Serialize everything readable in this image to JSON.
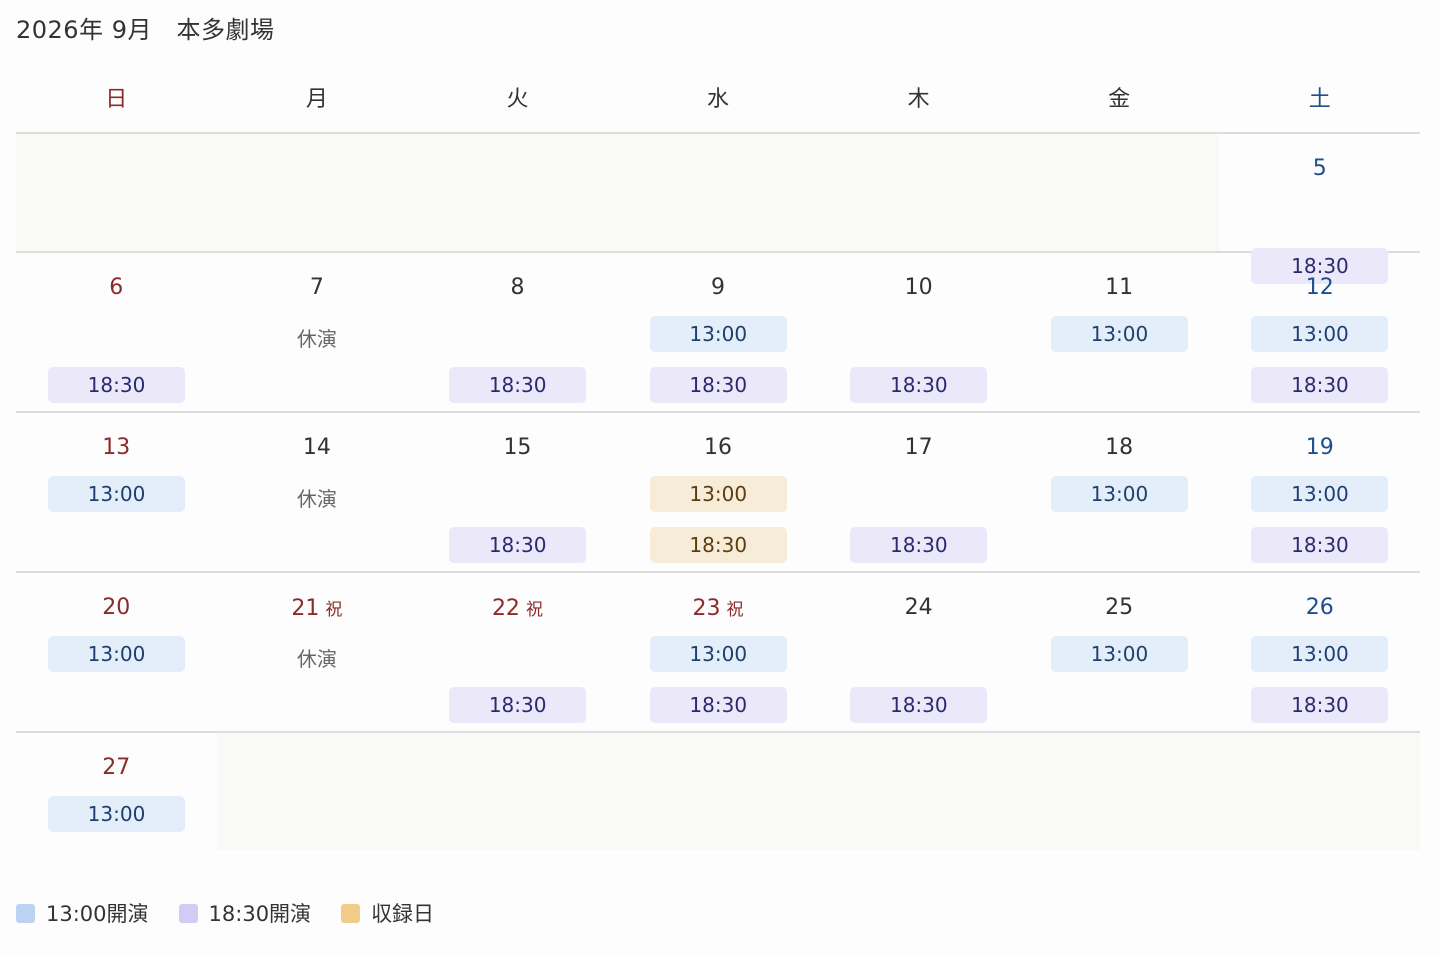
{
  "header": {
    "title": "2026年 9月　本多劇場"
  },
  "weekdays": [
    "日",
    "月",
    "火",
    "水",
    "木",
    "金",
    "土"
  ],
  "weeks": [
    {
      "days": [
        null,
        null,
        null,
        null,
        null,
        null,
        {
          "day": "5",
          "slots": [
            null,
            {
              "time": "18:30",
              "type": "t1830"
            }
          ]
        }
      ]
    },
    {
      "days": [
        {
          "day": "6",
          "slots": [
            null,
            {
              "time": "18:30",
              "type": "t1830"
            }
          ]
        },
        {
          "day": "7",
          "closed": "休演",
          "slots": [
            null,
            null
          ]
        },
        {
          "day": "8",
          "slots": [
            null,
            {
              "time": "18:30",
              "type": "t1830"
            }
          ]
        },
        {
          "day": "9",
          "slots": [
            {
              "time": "13:00",
              "type": "t1300"
            },
            {
              "time": "18:30",
              "type": "t1830"
            }
          ]
        },
        {
          "day": "10",
          "slots": [
            null,
            {
              "time": "18:30",
              "type": "t1830"
            }
          ]
        },
        {
          "day": "11",
          "slots": [
            {
              "time": "13:00",
              "type": "t1300"
            },
            null
          ]
        },
        {
          "day": "12",
          "slots": [
            {
              "time": "13:00",
              "type": "t1300"
            },
            {
              "time": "18:30",
              "type": "t1830"
            }
          ]
        }
      ]
    },
    {
      "days": [
        {
          "day": "13",
          "slots": [
            {
              "time": "13:00",
              "type": "t1300"
            },
            null
          ]
        },
        {
          "day": "14",
          "closed": "休演",
          "slots": [
            null,
            null
          ]
        },
        {
          "day": "15",
          "slots": [
            null,
            {
              "time": "18:30",
              "type": "t1830"
            }
          ]
        },
        {
          "day": "16",
          "slots": [
            {
              "time": "13:00",
              "type": "rec"
            },
            {
              "time": "18:30",
              "type": "rec"
            }
          ]
        },
        {
          "day": "17",
          "slots": [
            null,
            {
              "time": "18:30",
              "type": "t1830"
            }
          ]
        },
        {
          "day": "18",
          "slots": [
            {
              "time": "13:00",
              "type": "t1300"
            },
            null
          ]
        },
        {
          "day": "19",
          "slots": [
            {
              "time": "13:00",
              "type": "t1300"
            },
            {
              "time": "18:30",
              "type": "t1830"
            }
          ]
        }
      ]
    },
    {
      "days": [
        {
          "day": "20",
          "slots": [
            {
              "time": "13:00",
              "type": "t1300"
            },
            null
          ]
        },
        {
          "day": "21",
          "holiday": "祝",
          "closed": "休演",
          "slots": [
            null,
            null
          ]
        },
        {
          "day": "22",
          "holiday": "祝",
          "slots": [
            null,
            {
              "time": "18:30",
              "type": "t1830"
            }
          ]
        },
        {
          "day": "23",
          "holiday": "祝",
          "slots": [
            {
              "time": "13:00",
              "type": "t1300"
            },
            {
              "time": "18:30",
              "type": "t1830"
            }
          ]
        },
        {
          "day": "24",
          "slots": [
            null,
            {
              "time": "18:30",
              "type": "t1830"
            }
          ]
        },
        {
          "day": "25",
          "slots": [
            {
              "time": "13:00",
              "type": "t1300"
            },
            null
          ]
        },
        {
          "day": "26",
          "slots": [
            {
              "time": "13:00",
              "type": "t1300"
            },
            {
              "time": "18:30",
              "type": "t1830"
            }
          ]
        }
      ]
    },
    {
      "days": [
        {
          "day": "27",
          "slots": [
            {
              "time": "13:00",
              "type": "t1300"
            },
            null
          ]
        },
        null,
        null,
        null,
        null,
        null,
        null
      ]
    }
  ],
  "legend": [
    {
      "label": "13:00開演",
      "color": "#bcd3f1"
    },
    {
      "label": "18:30開演",
      "color": "#d0ccf4"
    },
    {
      "label": "収録日",
      "color": "#f2cd8a"
    }
  ]
}
